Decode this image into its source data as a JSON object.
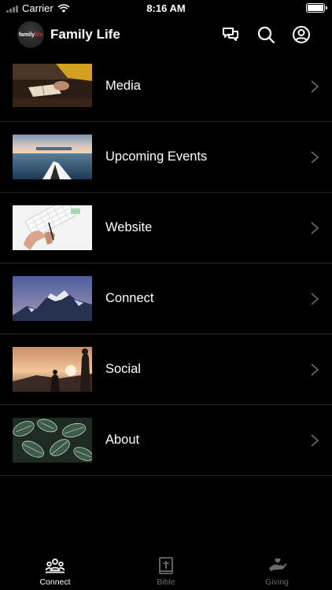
{
  "status_bar": {
    "carrier": "Carrier",
    "time": "8:16 AM"
  },
  "header": {
    "title": "Family Life",
    "logo_text_prefix": "family",
    "logo_text_suffix": "life"
  },
  "menu": [
    {
      "label": "Media",
      "icon": "chevron-right-icon"
    },
    {
      "label": "Upcoming Events",
      "icon": "chevron-right-icon"
    },
    {
      "label": "Website",
      "icon": "chevron-right-icon"
    },
    {
      "label": "Connect",
      "icon": "chevron-right-icon"
    },
    {
      "label": "Social",
      "icon": "chevron-right-icon"
    },
    {
      "label": "About",
      "icon": "chevron-right-icon"
    }
  ],
  "tabs": [
    {
      "label": "Connect",
      "icon": "people-icon",
      "active": true
    },
    {
      "label": "Bible",
      "icon": "bible-icon",
      "active": false
    },
    {
      "label": "Giving",
      "icon": "giving-icon",
      "active": false
    }
  ],
  "colors": {
    "background": "#000000",
    "text": "#ffffff",
    "inactive": "#6b6b6b",
    "divider": "#262626",
    "brand_red": "#e0282b"
  }
}
